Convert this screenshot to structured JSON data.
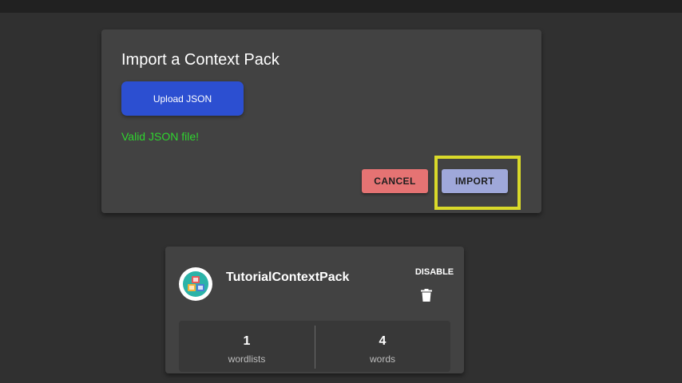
{
  "dialog": {
    "title": "Import a Context Pack",
    "upload_label": "Upload JSON",
    "status_text": "Valid JSON file!",
    "cancel_label": "CANCEL",
    "import_label": "IMPORT"
  },
  "pack_card": {
    "name": "TutorialContextPack",
    "avatar_icon": "abc-blocks-icon",
    "disable_label": "DISABLE",
    "delete_icon": "trash-icon",
    "stats": [
      {
        "value": "1",
        "label": "wordlists"
      },
      {
        "value": "4",
        "label": "words"
      }
    ]
  },
  "colors": {
    "background": "#303030",
    "surface": "#424242",
    "upload_button": "#2c4fd1",
    "status_valid": "#2fd42f",
    "cancel_button": "#e57373",
    "import_button": "#9fa8da",
    "highlight": "#d9d92a"
  }
}
